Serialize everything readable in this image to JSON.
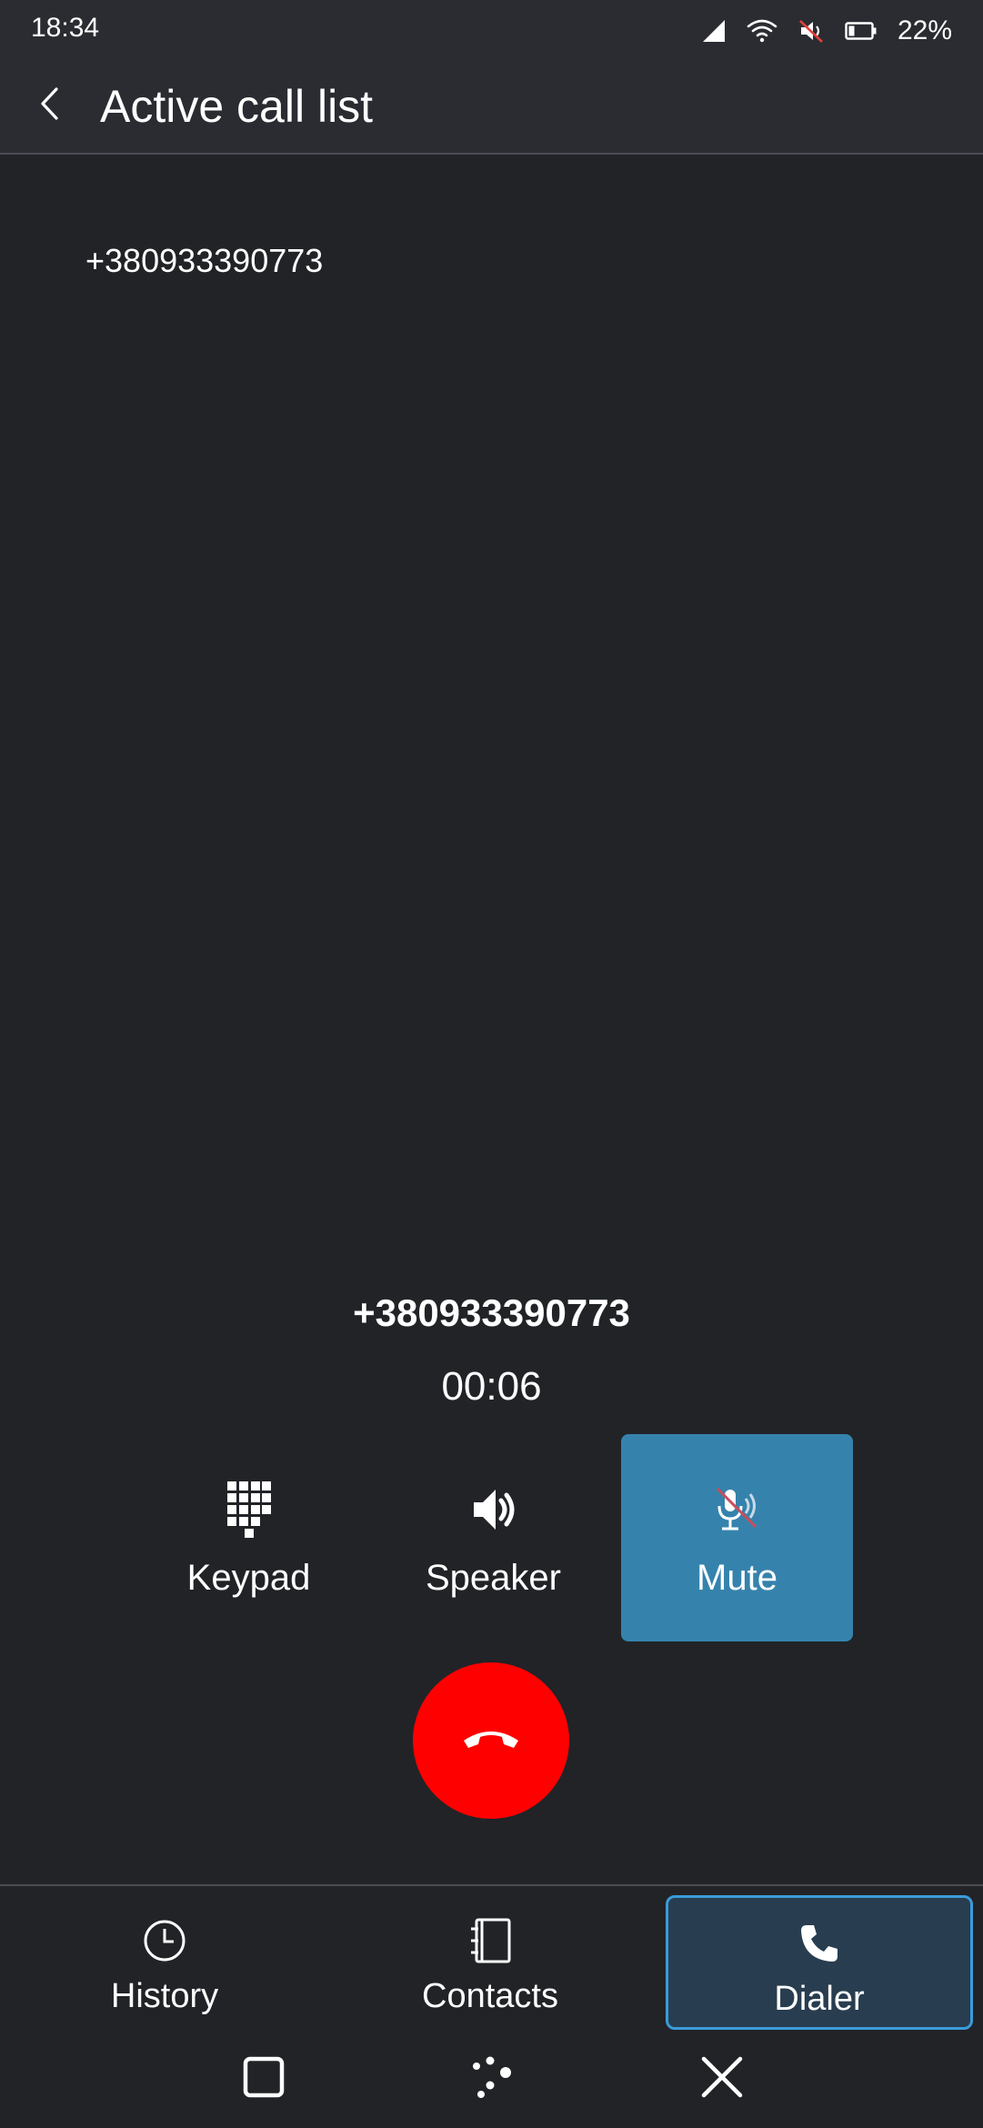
{
  "status_bar": {
    "time": "18:34",
    "battery_percent": "22%",
    "icons": [
      "signal-icon",
      "wifi-icon",
      "muted-volume-icon",
      "battery-icon"
    ]
  },
  "app_bar": {
    "title": "Active call list",
    "back_icon": "back-arrow-icon"
  },
  "call_list": [
    {
      "number": "+380933390773"
    }
  ],
  "active_call": {
    "number": "+380933390773",
    "timer": "00:06",
    "actions": {
      "keypad": "Keypad",
      "speaker": "Speaker",
      "mute": "Mute"
    },
    "mute_active": true,
    "end_call_icon": "hang-up-icon"
  },
  "bottom_nav": {
    "history": "History",
    "contacts": "Contacts",
    "dialer": "Dialer",
    "selected": "dialer"
  },
  "colors": {
    "background": "#212327",
    "bar": "#2a2c31",
    "mute_active": "#3583ad",
    "end_call": "#ff0000",
    "selected_nav_border": "#3a9bd9",
    "selected_nav_bg": "#283d4f"
  }
}
